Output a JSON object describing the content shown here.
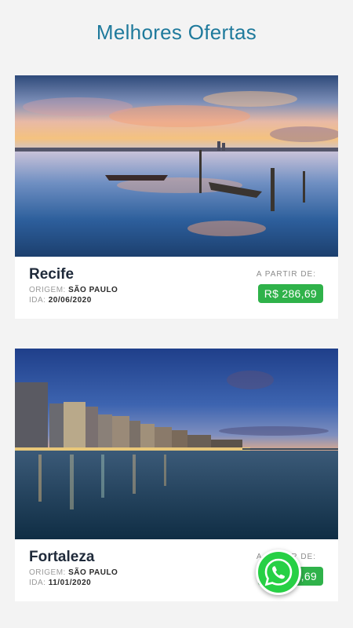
{
  "header": {
    "title": "Melhores Ofertas"
  },
  "offers": [
    {
      "city": "Recife",
      "origin_label": "ORIGEM:",
      "origin": "SÃO PAULO",
      "date_label": "IDA:",
      "date": "20/06/2020",
      "from_label": "A PARTIR DE:",
      "price": "R$ 286,69"
    },
    {
      "city": "Fortaleza",
      "origin_label": "ORIGEM:",
      "origin": "SÃO PAULO",
      "date_label": "IDA:",
      "date": "11/01/2020",
      "from_label": "A PARTIR DE:",
      "price": "R$ 286,69"
    }
  ],
  "fab": {
    "icon": "whatsapp-icon"
  },
  "colors": {
    "title": "#1f7a9c",
    "price_bg": "#2fb24a",
    "whatsapp": "#27d045"
  }
}
